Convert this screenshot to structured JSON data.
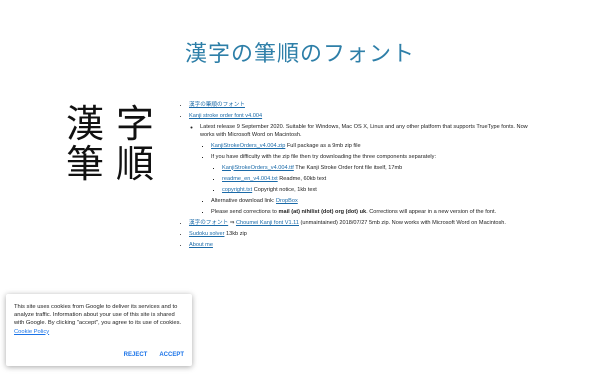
{
  "title": "漢字の筆順のフォント",
  "logo_chars": [
    "漢",
    "字",
    "筆",
    "順"
  ],
  "links": {
    "top_link": "漢字の筆順のフォント",
    "font_link": "Kanji stroke order font v4.004",
    "release_text": "Latest release 9 September 2020. Suitable for Windows, Mac OS X, Linux and any other platform that supports TrueType fonts. Now works with Microsoft Word on Macintosh.",
    "zip_link": "KanjiStrokeOrders_v4.004.zip",
    "zip_desc": " Full package as a 9mb zip file",
    "difficulty_text": "If you have difficulty with the zip file then try downloading the three components separately:",
    "ttf_link": "KanjiStrokeOrders_v4.004.ttf",
    "ttf_desc": " The Kanji Stroke Order font file itself, 17mb",
    "readme_link": "readme_en_v4.004.txt",
    "readme_desc": " Readme, 60kb text",
    "copyright_link": "copyright.txt",
    "copyright_desc": " Copyright notice, 1kb text",
    "alt_prefix": "Alternative download link: ",
    "dropbox_link": "DropBox",
    "corrections_prefix": "Please send corrections to ",
    "corrections_email": "mail (at) nihilist (dot) org (dot) uk",
    "corrections_suffix": ". Corrections will appear in a new version of the font.",
    "choumei_jp_link": "漢字のフォント",
    "choumei_arrow": " ⇒ ",
    "choumei_link": "Choumei Kanji font V1.11",
    "choumei_desc": " (unmaintained)  2018/07/27 5mb zip. Now works with Microsoft Word on Macintosh.",
    "sudoku_link": "Sudoku solver",
    "sudoku_desc": " 13kb zip",
    "about_link": "About me"
  },
  "cookie": {
    "text": "This site uses cookies from Google to deliver its services and to analyze traffic. Information about your use of this site is shared with Google. By clicking \"accept\", you agree to its use of cookies. ",
    "policy_link": "Cookie Policy",
    "reject": "REJECT",
    "accept": "ACCEPT"
  }
}
